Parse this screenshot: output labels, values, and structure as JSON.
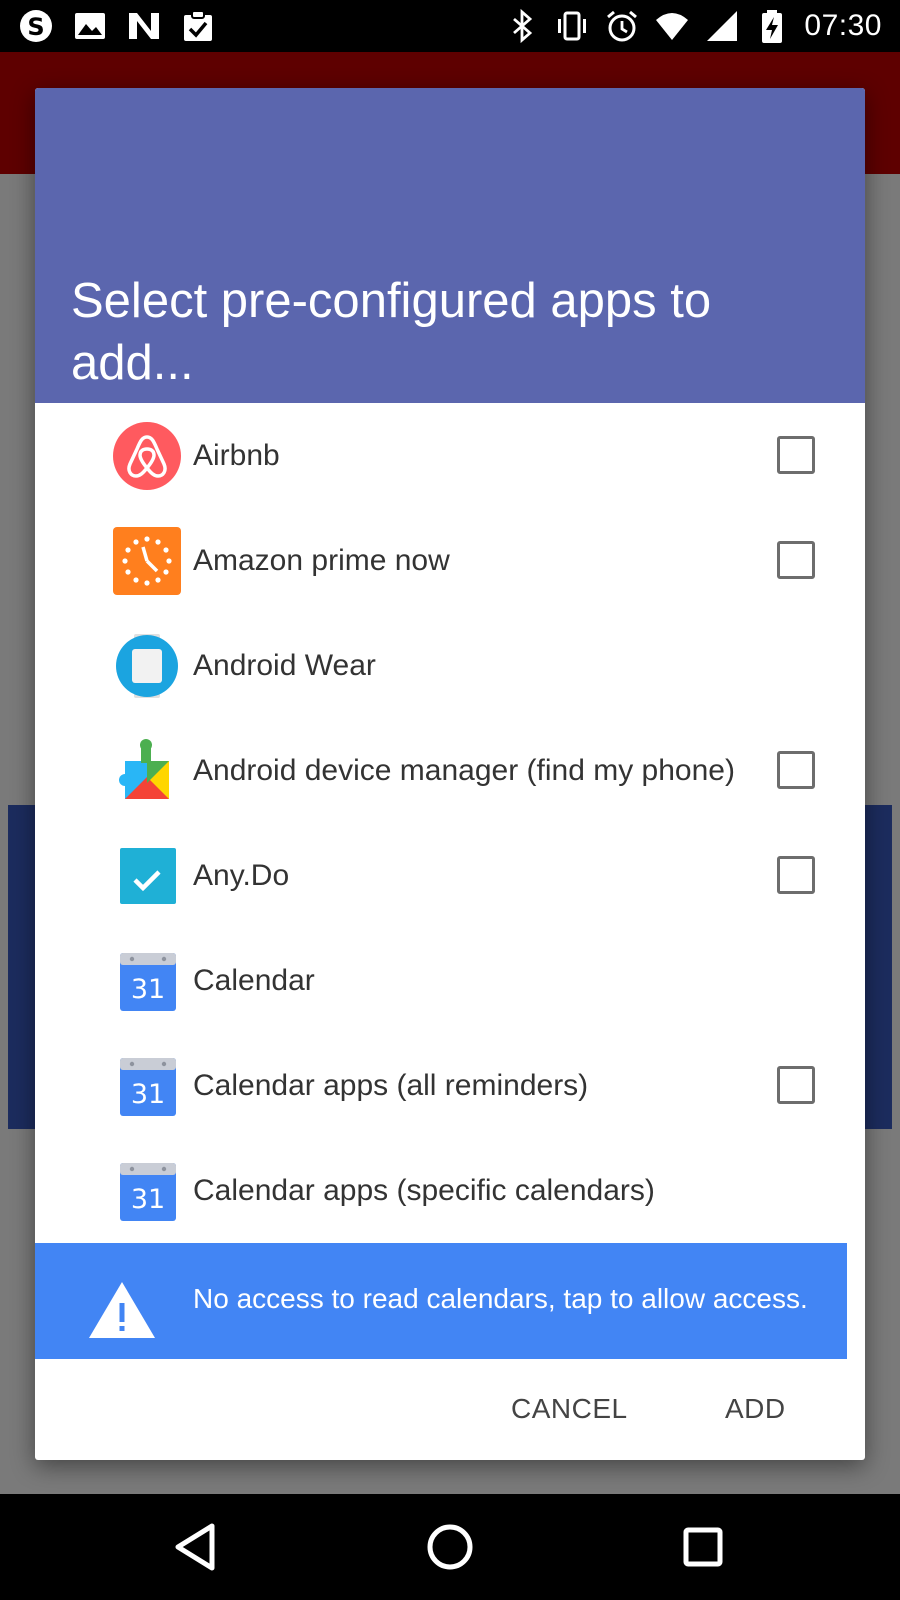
{
  "status_bar": {
    "time": "07:30",
    "left_icons": [
      "skype-icon",
      "image-icon",
      "n-app-icon",
      "clipboard-check-icon"
    ],
    "right_icons": [
      "bluetooth-icon",
      "vibrate-icon",
      "alarm-icon",
      "wifi-icon",
      "signal-icon",
      "battery-charging-icon"
    ]
  },
  "dialog": {
    "title": "Select pre-configured apps to add...",
    "header_color": "#5b66ae",
    "apps": [
      {
        "label": "Airbnb",
        "icon": "airbnb-icon",
        "checkbox": true
      },
      {
        "label": "Amazon prime now",
        "icon": "amazon-prime-now-icon",
        "checkbox": true
      },
      {
        "label": "Android Wear",
        "icon": "android-wear-icon",
        "checkbox": false
      },
      {
        "label": "Android device manager (find my phone)",
        "icon": "android-device-manager-icon",
        "checkbox": true
      },
      {
        "label": "Any.Do",
        "icon": "anydo-icon",
        "checkbox": true
      },
      {
        "label": "Calendar",
        "icon": "calendar-icon",
        "checkbox": false
      },
      {
        "label": "Calendar apps (all reminders)",
        "icon": "calendar-icon",
        "checkbox": true
      },
      {
        "label": "Calendar apps (specific calendars)",
        "icon": "calendar-icon",
        "checkbox": false
      }
    ],
    "calendar_icon_number": "31",
    "warning": {
      "text": "No access to read calendars, tap to allow access.",
      "icon": "warning-icon",
      "color": "#4285f4"
    },
    "actions": {
      "cancel": "CANCEL",
      "add": "ADD"
    }
  },
  "nav_bar": {
    "icons": [
      "back-icon",
      "home-icon",
      "recents-icon"
    ]
  }
}
